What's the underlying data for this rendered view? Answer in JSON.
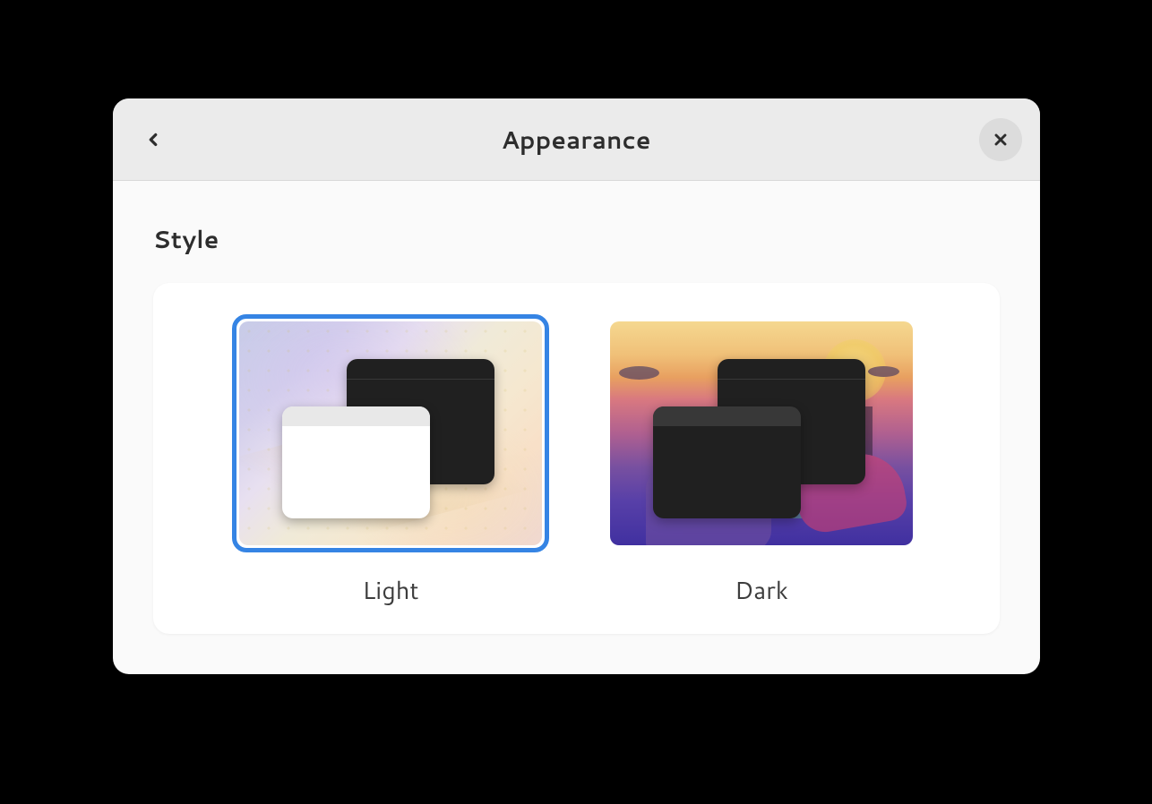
{
  "header": {
    "title": "Appearance"
  },
  "section": {
    "title": "Style"
  },
  "options": {
    "light": {
      "label": "Light",
      "selected": true
    },
    "dark": {
      "label": "Dark",
      "selected": false
    }
  }
}
